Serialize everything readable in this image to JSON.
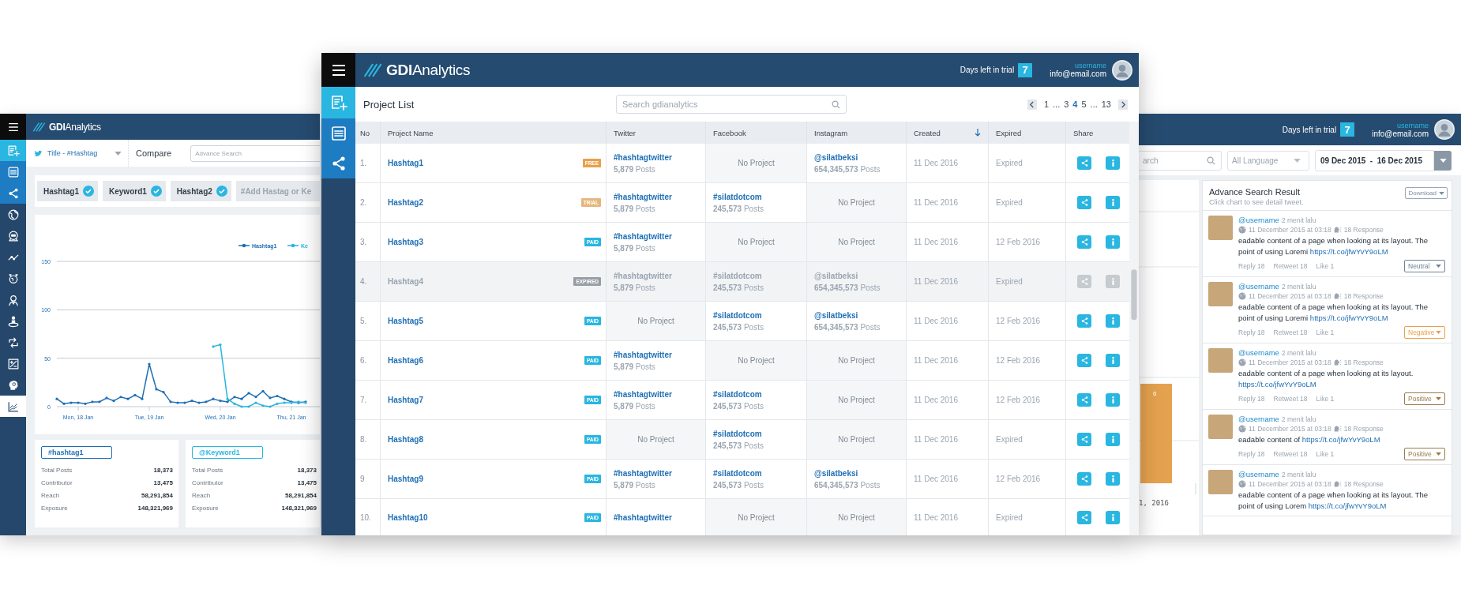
{
  "left_window": {
    "logo": "**GDI**Analytics",
    "sidebar": [
      {
        "kind": "add",
        "selected": false
      },
      {
        "kind": "list",
        "selected": false
      },
      {
        "kind": "share",
        "selected": false
      },
      {
        "kind": "globe",
        "selected": false
      },
      {
        "kind": "chat",
        "selected": false
      },
      {
        "kind": "trend",
        "selected": false
      },
      {
        "kind": "world",
        "selected": false
      },
      {
        "kind": "person",
        "selected": false
      },
      {
        "kind": "podium",
        "selected": false
      },
      {
        "kind": "retweet",
        "selected": false
      },
      {
        "kind": "edit",
        "selected": false
      },
      {
        "kind": "head",
        "selected": false
      },
      {
        "kind": "chart",
        "selected": true
      }
    ],
    "title_select": "Title - #Hashtag",
    "compare": "Compare",
    "search": {
      "placeholder": "Advance Search"
    },
    "tags": [
      {
        "label": "Hashtag1",
        "checked": true
      },
      {
        "label": "Keyword1",
        "checked": true
      },
      {
        "label": "Hashtag2",
        "checked": true
      }
    ],
    "tag_input": {
      "placeholder": "#Add Hastag or Ke"
    },
    "chart_data": {
      "type": "line",
      "categories": [
        null,
        null,
        null,
        "Mon, 18 Jan",
        null,
        null,
        null,
        null,
        null,
        null,
        null,
        null,
        null,
        "Tue, 19 Jan",
        null,
        null,
        null,
        null,
        null,
        null,
        null,
        null,
        null,
        "Wed, 20 Jan",
        null,
        null,
        null,
        null,
        null,
        null,
        null,
        null,
        null,
        "Thu, 21 Jan",
        null,
        null
      ],
      "ylim": [
        0,
        150
      ],
      "yticks": [
        0,
        50,
        100,
        150
      ],
      "grid": true,
      "legend": true,
      "series": [
        {
          "name": "Hashtag1",
          "color": "#1f6fb5",
          "values": [
            8,
            3,
            4,
            4,
            3,
            5,
            5,
            9,
            6,
            10,
            8,
            12,
            8,
            44,
            18,
            15,
            5,
            4,
            4,
            6,
            4,
            5,
            8,
            6,
            5,
            10,
            8,
            14,
            10,
            16,
            9,
            11,
            8,
            5,
            4,
            5
          ]
        },
        {
          "name": "Ke",
          "color": "#29b6e0",
          "values": [
            null,
            null,
            null,
            null,
            null,
            null,
            null,
            null,
            null,
            null,
            null,
            null,
            null,
            null,
            null,
            null,
            null,
            null,
            null,
            null,
            null,
            null,
            62,
            64,
            8,
            3,
            0,
            0,
            4,
            1,
            0,
            3,
            4,
            4,
            5,
            4
          ]
        }
      ]
    },
    "stats_cards": [
      {
        "tag": "#hashtag1",
        "color": "#1f6fb5",
        "rows": [
          {
            "label": "Total Posts",
            "value": "18,373"
          },
          {
            "label": "Contributor",
            "value": "13,475"
          },
          {
            "label": "Reach",
            "value": "58,291,854"
          },
          {
            "label": "Exposure",
            "value": "148,321,969"
          }
        ]
      },
      {
        "tag": "@Keyword1",
        "color": "#29b6e0",
        "rows": [
          {
            "label": "Total Posts",
            "value": "18,373"
          },
          {
            "label": "Contributor",
            "value": "13,475"
          },
          {
            "label": "Reach",
            "value": "58,291,854"
          },
          {
            "label": "Exposure",
            "value": "148,321,969"
          }
        ]
      }
    ]
  },
  "center_window": {
    "logo": "**GDI**Analytics",
    "trial": {
      "label": "Days left in trial",
      "days": "7"
    },
    "user": {
      "name": "username",
      "email": "info@email.com"
    },
    "sidebar": [
      {
        "kind": "add",
        "selected": true
      },
      {
        "kind": "list",
        "selected": false
      },
      {
        "kind": "share",
        "selected": false
      }
    ],
    "title": "Project List",
    "search": {
      "placeholder": "Search gdianalytics"
    },
    "pagination": [
      {
        "label": "1",
        "selected": false
      },
      {
        "label": "...",
        "selected": false
      },
      {
        "label": "3",
        "selected": false
      },
      {
        "label": "4",
        "selected": true
      },
      {
        "label": "5",
        "selected": false
      },
      {
        "label": "...",
        "selected": false
      },
      {
        "label": "13",
        "selected": false
      }
    ],
    "table": {
      "columns": [
        {
          "label": "No",
          "sorted": false
        },
        {
          "label": "Project Name",
          "sorted": false
        },
        {
          "label": "Twitter",
          "sorted": false
        },
        {
          "label": "Facebook",
          "sorted": false
        },
        {
          "label": "Instagram",
          "sorted": false
        },
        {
          "label": "Created",
          "sorted": true
        },
        {
          "label": "Expired",
          "sorted": false
        },
        {
          "label": "Share",
          "sorted": false
        }
      ],
      "rows": [
        {
          "no": "1.",
          "name": "Hashtag1",
          "badge": {
            "text": "FREE",
            "color": "#e8a04c"
          },
          "disabled": false,
          "twitter": {
            "kind": "project",
            "handle": "#hashtagtwitter",
            "posts": "**5,879** Posts"
          },
          "facebook": {
            "kind": "none",
            "text": "No Project"
          },
          "instagram": {
            "kind": "project",
            "handle": "@silatbeksi",
            "posts": "**654,345,573** Posts"
          },
          "created": "11 Dec 2016",
          "expired": "Expired"
        },
        {
          "no": "2.",
          "name": "Hashtag2",
          "badge": {
            "text": "TRIAL",
            "color": "#e6b67e"
          },
          "disabled": false,
          "twitter": {
            "kind": "project",
            "handle": "#hashtagtwitter",
            "posts": "**5,879** Posts"
          },
          "facebook": {
            "kind": "project",
            "handle": "#silatdotcom",
            "posts": "**245,573** Posts"
          },
          "instagram": {
            "kind": "none",
            "text": "No Project"
          },
          "created": "11 Dec 2016",
          "expired": "Expired"
        },
        {
          "no": "3.",
          "name": "Hashtag3",
          "badge": {
            "text": "PAID",
            "color": "#29b6e0"
          },
          "disabled": false,
          "twitter": {
            "kind": "project",
            "handle": "#hashtagtwitter",
            "posts": "**5,879** Posts"
          },
          "facebook": {
            "kind": "none",
            "text": "No Project"
          },
          "instagram": {
            "kind": "none",
            "text": "No Project"
          },
          "created": "11 Dec 2016",
          "expired": "12 Feb 2016"
        },
        {
          "no": "4.",
          "name": "Hashtag4",
          "badge": {
            "text": "EXPIRED",
            "color": "#979ea5"
          },
          "disabled": true,
          "twitter": {
            "kind": "project",
            "handle": "#hashtagtwitter",
            "posts": "**5,879** Posts"
          },
          "facebook": {
            "kind": "project",
            "handle": "#silatdotcom",
            "posts": "**245,573** Posts"
          },
          "instagram": {
            "kind": "project",
            "handle": "@silatbeksi",
            "posts": "**654,345,573** Posts"
          },
          "created": "11 Dec 2016",
          "expired": "Expired"
        },
        {
          "no": "5.",
          "name": "Hashtag5",
          "badge": {
            "text": "PAID",
            "color": "#29b6e0"
          },
          "disabled": false,
          "twitter": {
            "kind": "none",
            "text": "No Project"
          },
          "facebook": {
            "kind": "project",
            "handle": "#silatdotcom",
            "posts": "**245,573** Posts"
          },
          "instagram": {
            "kind": "project",
            "handle": "@silatbeksi",
            "posts": "**654,345,573** Posts"
          },
          "created": "11 Dec 2016",
          "expired": "12 Feb 2016"
        },
        {
          "no": "6.",
          "name": "Hashtag6",
          "badge": {
            "text": "PAID",
            "color": "#29b6e0"
          },
          "disabled": false,
          "twitter": {
            "kind": "project",
            "handle": "#hashtagtwitter",
            "posts": "**5,879** Posts"
          },
          "facebook": {
            "kind": "none",
            "text": "No Project"
          },
          "instagram": {
            "kind": "none",
            "text": "No Project"
          },
          "created": "11 Dec 2016",
          "expired": "12 Feb 2016"
        },
        {
          "no": "7.",
          "name": "Hashtag7",
          "badge": {
            "text": "PAID",
            "color": "#29b6e0"
          },
          "disabled": false,
          "twitter": {
            "kind": "project",
            "handle": "#hashtagtwitter",
            "posts": "**5,879** Posts"
          },
          "facebook": {
            "kind": "project",
            "handle": "#silatdotcom",
            "posts": "**245,573** Posts"
          },
          "instagram": {
            "kind": "none",
            "text": "No Project"
          },
          "created": "11 Dec 2016",
          "expired": "12 Feb 2016"
        },
        {
          "no": "8.",
          "name": "Hashtag8",
          "badge": {
            "text": "PAID",
            "color": "#29b6e0"
          },
          "disabled": false,
          "twitter": {
            "kind": "none",
            "text": "No Project"
          },
          "facebook": {
            "kind": "project",
            "handle": "#silatdotcom",
            "posts": "**245,573** Posts"
          },
          "instagram": {
            "kind": "none",
            "text": "No Project"
          },
          "created": "11 Dec 2016",
          "expired": "Expired"
        },
        {
          "no": "9",
          "name": "Hashtag9",
          "badge": {
            "text": "PAID",
            "color": "#29b6e0"
          },
          "disabled": false,
          "twitter": {
            "kind": "project",
            "handle": "#hashtagtwitter",
            "posts": "**5,879** Posts"
          },
          "facebook": {
            "kind": "project",
            "handle": "#silatdotcom",
            "posts": "**245,573** Posts"
          },
          "instagram": {
            "kind": "project",
            "handle": "@silatbeksi",
            "posts": "**654,345,573** Posts"
          },
          "created": "11 Dec 2016",
          "expired": "12 Feb 2016"
        },
        {
          "no": "10.",
          "name": "Hashtag10",
          "badge": {
            "text": "PAID",
            "color": "#29b6e0"
          },
          "disabled": false,
          "twitter": {
            "kind": "project",
            "handle": "#hashtagtwitter"
          },
          "facebook": {
            "kind": "none",
            "text": "No Project"
          },
          "instagram": {
            "kind": "none",
            "text": "No Project"
          },
          "created": "11 Dec 2016",
          "expired": "Expired"
        }
      ]
    }
  },
  "right_window": {
    "trial": {
      "label": "Days left in trial",
      "days": "7"
    },
    "user": {
      "name": "username",
      "email": "info@email.com"
    },
    "search": {
      "placeholder": "arch"
    },
    "language": "All Language",
    "date_range": "09 Dec 2015  -  16 Dec 2015",
    "chart_fragment": {
      "bar_label": "6",
      "axis_label": "1, 2016"
    },
    "results": {
      "title": "Advance Search Result",
      "subtitle": "Click chart to see detail tweet.",
      "download": "Download",
      "tweets": [
        {
          "user": "@username",
          "time": "2 menit lalu",
          "date": "11 December 2015 at 03:18",
          "responses": "18 Response",
          "text": "eadable content of a page when looking at its layout. The point of using Loremi",
          "link": "https://t.co/jfwYvY9oLM",
          "actions": [
            "Reply 18",
            "Retweet 18",
            "Like 1"
          ],
          "sentiment": {
            "label": "Neutral",
            "color": "#6f8396"
          }
        },
        {
          "user": "@username",
          "time": "2 menit lalu",
          "date": "11 December 2015 at 03:18",
          "responses": "18 Response",
          "text": "eadable content of a page when looking at its layout. The point of using Loremi",
          "link": "https://t.co/jfwYvY9oLM",
          "actions": [
            "Reply 18",
            "Retweet 18",
            "Like 1"
          ],
          "sentiment": {
            "label": "Negative",
            "color": "#e8a04c"
          }
        },
        {
          "user": "@username",
          "time": "2 menit lalu",
          "date": "11 December 2015 at 03:18",
          "responses": "18 Response",
          "text": "eadable content of a page when looking at its layout.",
          "link": "https://t.co/jfwYvY9oLM",
          "actions": [
            "Reply 18",
            "Retweet 18",
            "Like 1"
          ],
          "sentiment": {
            "label": "Positive",
            "color": "#9a7a4a"
          }
        },
        {
          "user": "@username",
          "time": "2 menit lalu",
          "date": "11 December 2015 at 03:18",
          "responses": "18 Response",
          "text": "eadable content of",
          "link": "https://t.co/jfwYvY9oLM",
          "actions": [
            "Reply 18",
            "Retweet 18",
            "Like 1"
          ],
          "sentiment": {
            "label": "Positive",
            "color": "#9a7a4a"
          }
        },
        {
          "user": "@username",
          "time": "2 menit lalu",
          "date": "11 December 2015 at 03:18",
          "responses": "18 Response",
          "text": "eadable content of a page when looking at its layout. The point of using Lorem",
          "link": "https://t.co/jfwYvY9oLM"
        }
      ]
    }
  }
}
